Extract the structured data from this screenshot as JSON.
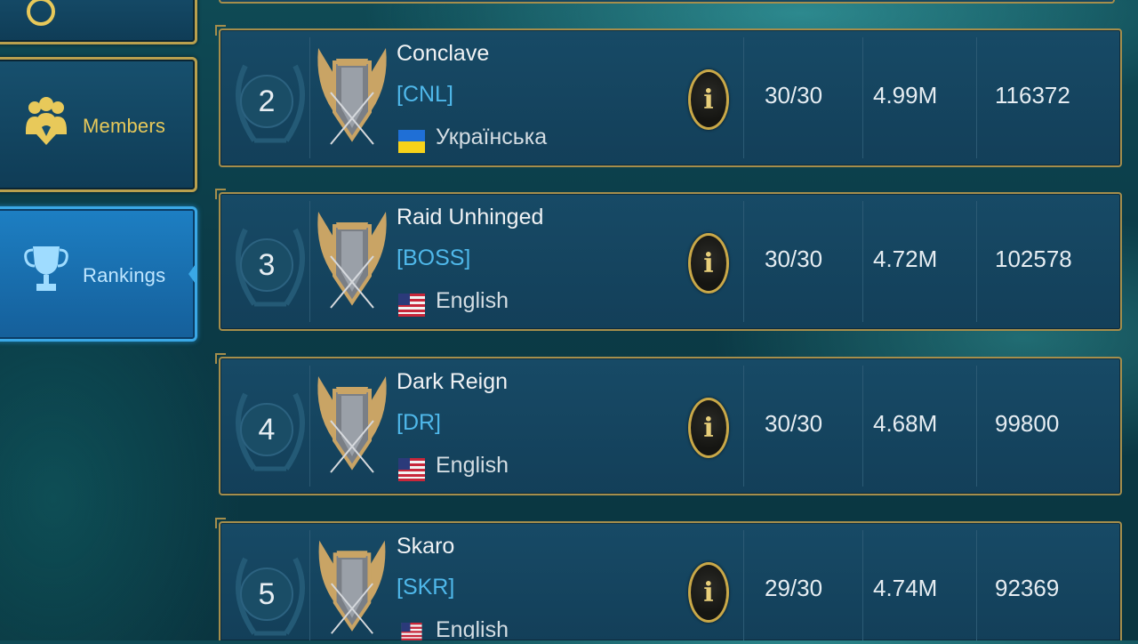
{
  "nav": {
    "items": [
      {
        "label": "",
        "icon": "emblem-icon",
        "active": false
      },
      {
        "label": "Members",
        "icon": "members-icon",
        "active": false
      },
      {
        "label": "Rankings",
        "icon": "trophy-icon",
        "active": true
      }
    ]
  },
  "rankings": [
    {
      "rank": "2",
      "name": "Conclave",
      "tag": "[CNL]",
      "language": "Українська",
      "flag": "ukraine-flag-icon",
      "members": "30/30",
      "power": "4.99M",
      "score": "116372"
    },
    {
      "rank": "3",
      "name": "Raid Unhinged",
      "tag": "[BOSS]",
      "language": "English",
      "flag": "us-flag-icon",
      "members": "30/30",
      "power": "4.72M",
      "score": "102578"
    },
    {
      "rank": "4",
      "name": "Dark Reign",
      "tag": "[DR]",
      "language": "English",
      "flag": "us-flag-icon",
      "members": "30/30",
      "power": "4.68M",
      "score": "99800"
    },
    {
      "rank": "5",
      "name": "Skaro",
      "tag": "[SKR]",
      "language": "English",
      "flag": "us-flag-icon",
      "members": "29/30",
      "power": "4.74M",
      "score": "92369"
    }
  ],
  "colors": {
    "gold": "#b9a04e",
    "active_blue": "#1d7fc3",
    "tag_blue": "#4fb8ea"
  }
}
